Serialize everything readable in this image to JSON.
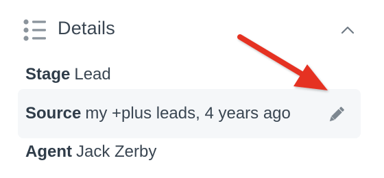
{
  "header": {
    "title": "Details",
    "icon": "list-icon",
    "collapse_icon": "chevron-up-icon"
  },
  "fields": [
    {
      "label": "Stage",
      "value": "Lead"
    },
    {
      "label": "Source",
      "value": "my +plus leads, 4 years ago",
      "edit_icon": "pencil-icon",
      "highlighted": true
    },
    {
      "label": "Agent",
      "value": "Jack Zerby"
    }
  ],
  "colors": {
    "text": "#3a4652",
    "label": "#2f3c49",
    "icon": "#8b949c",
    "highlight_bg": "#f5f7f9",
    "annotation_arrow": "#e53023"
  }
}
